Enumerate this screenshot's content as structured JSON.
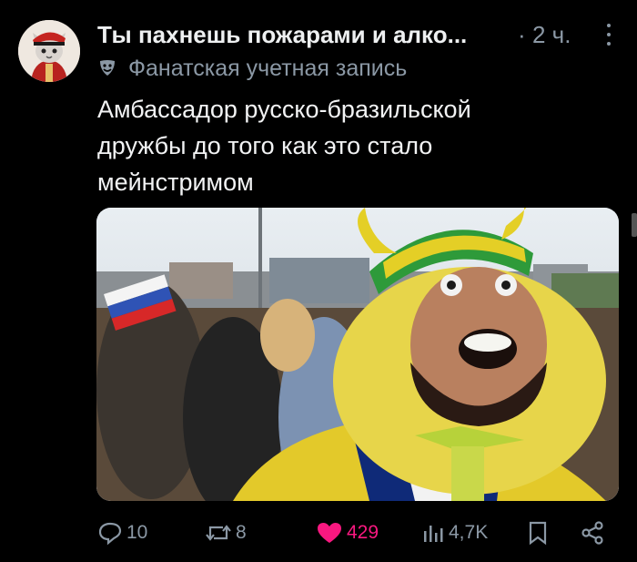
{
  "post": {
    "author_name": "Ты пахнешь пожарами и алко...",
    "separator": "·",
    "timestamp": "2 ч.",
    "badge_icon": "theater-mask-icon",
    "badge_text": "Фанатская учетная запись",
    "text": "Амбассадор русско-бразильской\nдружбы до того как это стало\nмейнстримом",
    "media_description_icon": "video-still"
  },
  "actions": {
    "reply_count": "10",
    "repost_count": "8",
    "like_count": "429",
    "views_count": "4,7K",
    "like_color": "#f91880"
  },
  "colors": {
    "background": "#000000",
    "muted": "#8b98a5",
    "text": "#e7e9ea"
  }
}
